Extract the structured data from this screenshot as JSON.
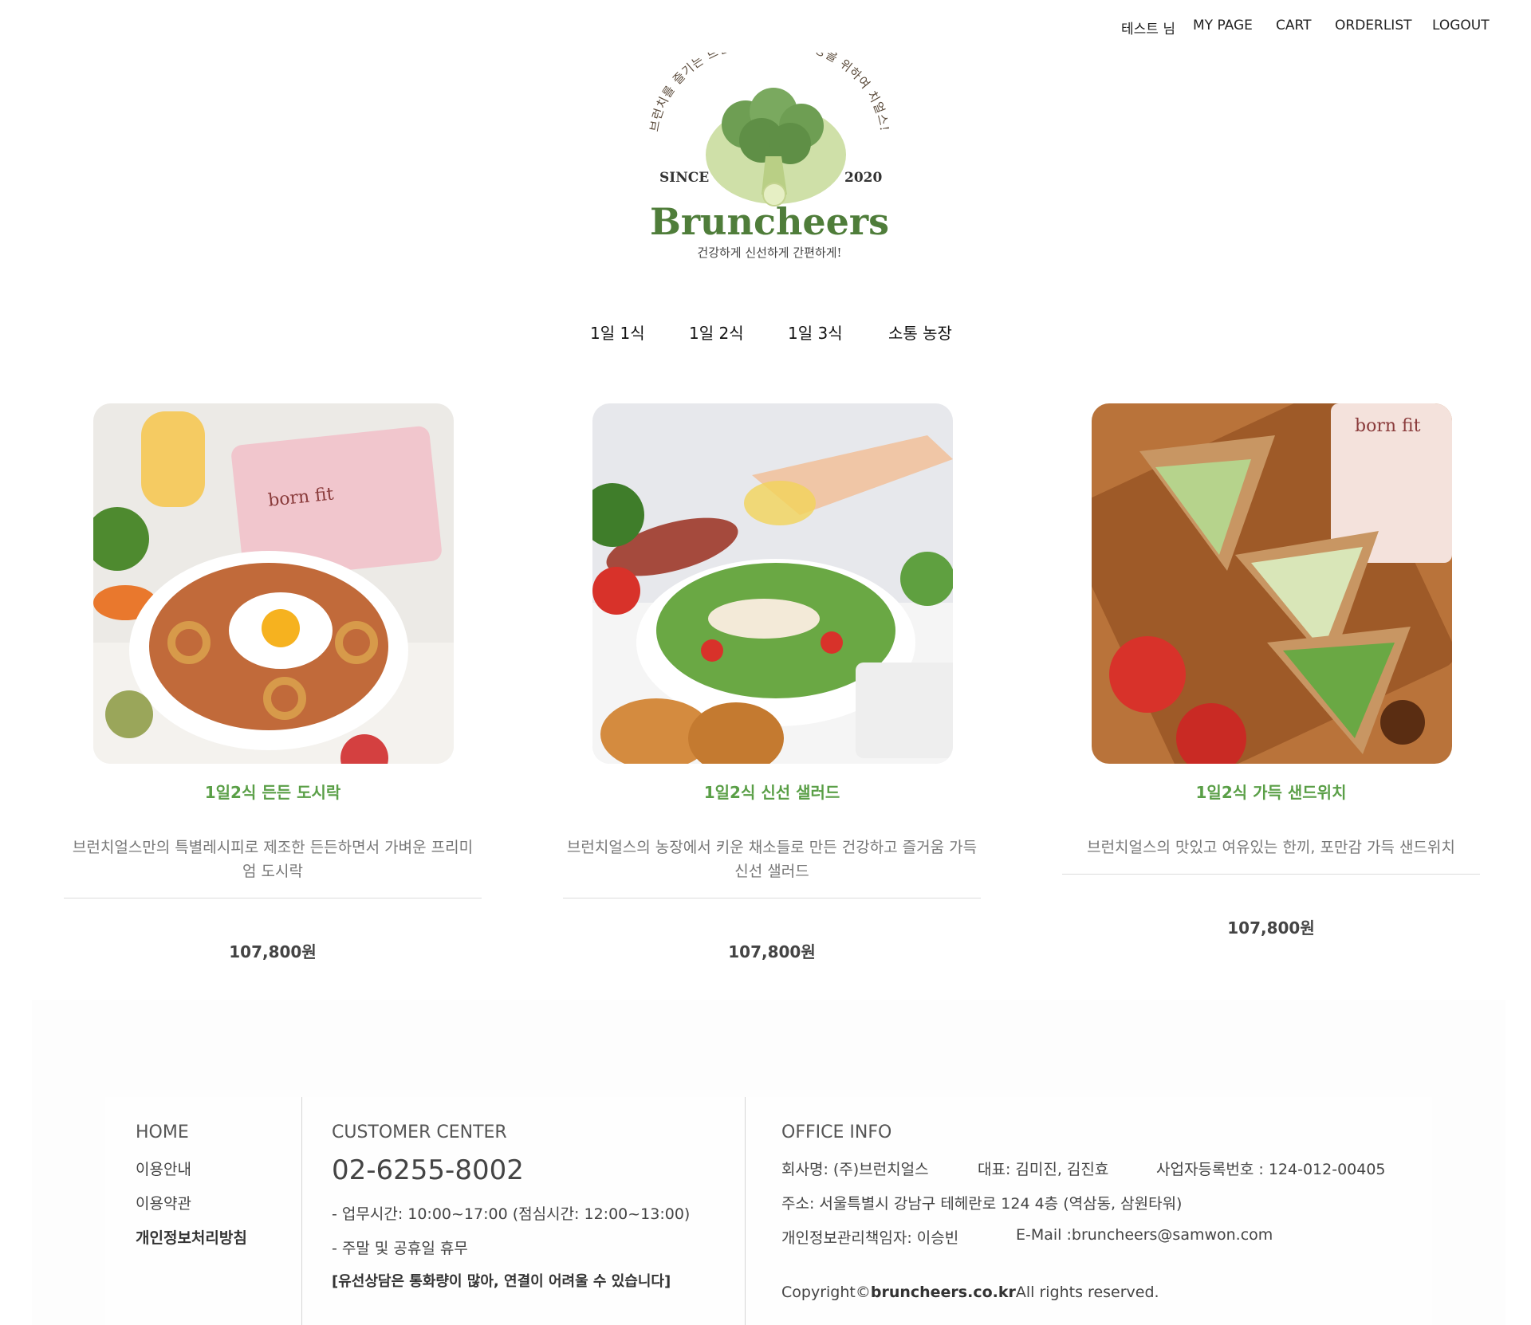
{
  "topnav": {
    "user": "테스트 님",
    "mypage": "MY PAGE",
    "cart": "CART",
    "orderlist": "ORDERLIST",
    "logout": "LOGOUT"
  },
  "logo": {
    "arc_text": "브런치를 즐기는 브런치어, 당신의 건강을 위하여 치얼스!",
    "since": "SINCE",
    "year": "2020",
    "brand": "Bruncheers",
    "tagline": "건강하게 신선하게 간편하게!"
  },
  "mainnav": {
    "items": [
      "1일 1식",
      "1일 2식",
      "1일 3식",
      "소통 농장"
    ]
  },
  "products": [
    {
      "name": "1일2식 든든 도시락",
      "desc": "브런치얼스만의 특별레시피로 제조한 든든하면서 가벼운 프리미엄 도시락",
      "price": "107,800원",
      "image": "rice-bowl-photo"
    },
    {
      "name": "1일2식 신선 샐러드",
      "desc": "브런치얼스의 농장에서 키운 채소들로 만든 건강하고 즐거움 가득 신선 샐러드",
      "price": "107,800원",
      "image": "salad-photo"
    },
    {
      "name": "1일2식 가득 샌드위치",
      "desc": "브런치얼스의 맛있고 여유있는 한끼, 포만감 가득 샌드위치",
      "price": "107,800원",
      "image": "sandwich-photo"
    }
  ],
  "footer": {
    "home": "HOME",
    "links": [
      "이용안내",
      "이용약관",
      "개인정보처리방침"
    ],
    "cs_title": "CUSTOMER CENTER",
    "cs_phone": "02-6255-8002",
    "cs_hours": "- 업무시간: 10:00~17:00 (점심시간: 12:00~13:00)",
    "cs_holiday": "- 주말 및 공휴일 휴무",
    "cs_notice": "[유선상담은 통화량이 많아, 연결이 어려울 수 있습니다]",
    "office_title": "OFFICE INFO",
    "company": "회사명: (주)브런치얼스",
    "ceo": "대표: 김미진, 김진효",
    "biz_no": "사업자등록번호 : 124-012-00405",
    "address": "주소: 서울특별시 강남구 테헤란로 124 4층 (역삼동, 삼원타워)",
    "privacy_officer": "개인정보관리책임자: 이승빈",
    "email": "E-Mail :bruncheers@samwon.com",
    "copyright_pre": "Copyright©",
    "copyright_domain": "bruncheers.co.kr",
    "copyright_post": "All rights reserved."
  },
  "colors": {
    "accent_green": "#5a9f47",
    "brand_green": "#4f7d3a",
    "text_gray": "#777777"
  }
}
